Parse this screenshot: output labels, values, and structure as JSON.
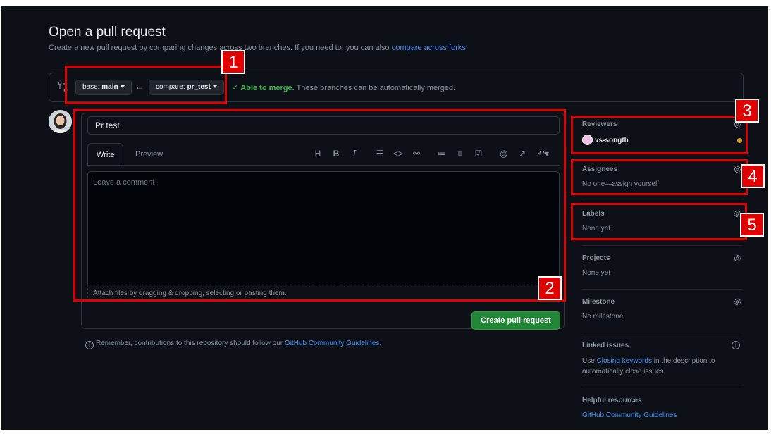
{
  "header": {
    "title": "Open a pull request",
    "subtitle": "Create a new pull request by comparing changes across two branches. If you need to, you can also",
    "subtitle_link": "compare across forks."
  },
  "branches": {
    "base_prefix": "base:",
    "base": "main",
    "compare_prefix": "compare:",
    "compare": "pr_test",
    "status_ok": "Able to merge.",
    "status_text": "These branches can be automatically merged."
  },
  "editor": {
    "title_value": "Pr test",
    "tab_write": "Write",
    "tab_preview": "Preview",
    "toolbar_icons": [
      "heading-icon",
      "bold-icon",
      "italic-icon",
      "quote-icon",
      "code-icon",
      "link-icon",
      "bulleted-list-icon",
      "numbered-list-icon",
      "task-list-icon",
      "mention-icon",
      "reference-icon",
      "reply-icon"
    ],
    "comment_placeholder": "Leave a comment",
    "attach_text": "Attach files by dragging & dropping, selecting or pasting them.",
    "submit_label": "Create pull request"
  },
  "reminder": {
    "text": "Remember, contributions to this repository should follow our",
    "link": "GitHub Community Guidelines",
    "end": "."
  },
  "sidebar": {
    "reviewers_title": "Reviewers",
    "reviewer_name": "vs-songth",
    "assignees_title": "Assignees",
    "assignees_value": "No one—assign yourself",
    "labels_title": "Labels",
    "labels_value": "None yet",
    "projects_title": "Projects",
    "projects_value": "None yet",
    "milestone_title": "Milestone",
    "milestone_value": "No milestone",
    "linked_title": "Linked issues",
    "linked_pre": "Use",
    "linked_link": "Closing keywords",
    "linked_post": "in the description to",
    "linked_line2": "automatically close issues",
    "helpful_title": "Helpful resources",
    "helpful_link": "GitHub Community Guidelines"
  },
  "annotations": [
    "1",
    "2",
    "3",
    "4",
    "5"
  ],
  "colors": {
    "background": "#0d1117",
    "accent_green": "#238636",
    "link_blue": "#4493f8",
    "highlight_red": "#e00000"
  }
}
